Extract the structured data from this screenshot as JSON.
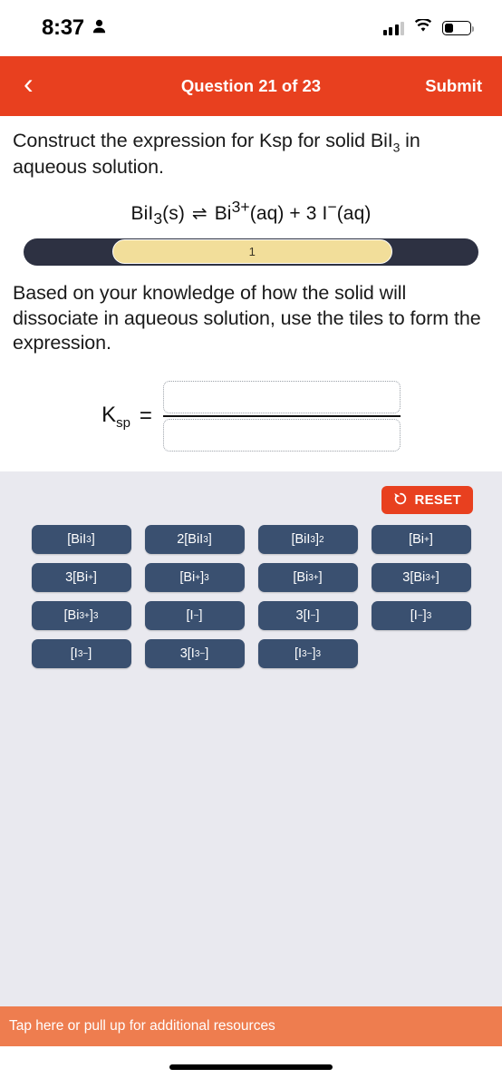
{
  "status_bar": {
    "time": "8:37",
    "person_icon": "person-icon",
    "signal_icon": "cellular-signal-icon",
    "wifi_icon": "wifi-icon",
    "battery_icon": "battery-icon"
  },
  "nav_bar": {
    "back_glyph": "‹",
    "title": "Question 21 of 23",
    "submit_label": "Submit",
    "color": "#E8401F"
  },
  "question": {
    "prompt_prefix": "Construct the expression for Ksp for solid BiI",
    "prompt_sub": "3",
    "prompt_suffix": " in aqueous solution.",
    "equation": {
      "reactant": "BiI",
      "reactant_sub": "3",
      "reactant_state": "(s)",
      "arrow": "⇌",
      "product1": "Bi",
      "product1_sup": "3+",
      "product1_state": "(aq)",
      "plus": "+",
      "coefficient": "3 ",
      "product2": "I",
      "product2_sup": "−",
      "product2_state": "(aq)"
    },
    "instructions": "Based on your knowledge of how the solid will dissociate in aqueous solution, use the tiles to form the expression."
  },
  "progress": {
    "value_label": "1",
    "track_color": "#2D3142",
    "fill_color": "#F2DE9A"
  },
  "answer": {
    "ksp_label_main": "K",
    "ksp_label_sub": "sp",
    "equals": "=",
    "numerator_value": "",
    "denominator_value": ""
  },
  "tray": {
    "reset_label": "RESET",
    "reset_icon": "reset-circular-arrow-icon",
    "background": "#E9E9EF",
    "tiles": [
      {
        "main": "[BiI",
        "sub": "3",
        "tail": "]",
        "sup": ""
      },
      {
        "lead": "2",
        "main": "[BiI",
        "sub": "3",
        "tail": "]",
        "sup": ""
      },
      {
        "main": "[BiI",
        "sub": "3",
        "tail": "]",
        "sup": "2"
      },
      {
        "main": "[Bi",
        "supin": "+",
        "tail": "]",
        "sup": ""
      },
      {
        "lead": "3",
        "main": "[Bi",
        "supin": "+",
        "tail": "]",
        "sup": ""
      },
      {
        "main": "[Bi",
        "supin": "+",
        "tail": "]",
        "sup": "3"
      },
      {
        "main": "[Bi",
        "supin": "3+",
        "tail": "]",
        "sup": ""
      },
      {
        "lead": "3",
        "main": "[Bi",
        "supin": "3+",
        "tail": "]",
        "sup": ""
      },
      {
        "main": "[Bi",
        "supin": "3+",
        "tail": "]",
        "sup": "3"
      },
      {
        "main": "[I",
        "supin": "−",
        "tail": "]",
        "sup": ""
      },
      {
        "lead": "3",
        "main": "[I",
        "supin": "−",
        "tail": "]",
        "sup": ""
      },
      {
        "main": "[I",
        "supin": "−",
        "tail": "]",
        "sup": "3"
      },
      {
        "main": "[I",
        "supin": "3−",
        "tail": "]",
        "sup": ""
      },
      {
        "lead": "3",
        "main": "[I",
        "supin": "3−",
        "tail": "]",
        "sup": ""
      },
      {
        "main": "[I",
        "supin": "3−",
        "tail": "]",
        "sup": "3"
      }
    ]
  },
  "resource_bar": {
    "label": "Tap here or pull up for additional resources",
    "color": "#EE7D4F"
  }
}
